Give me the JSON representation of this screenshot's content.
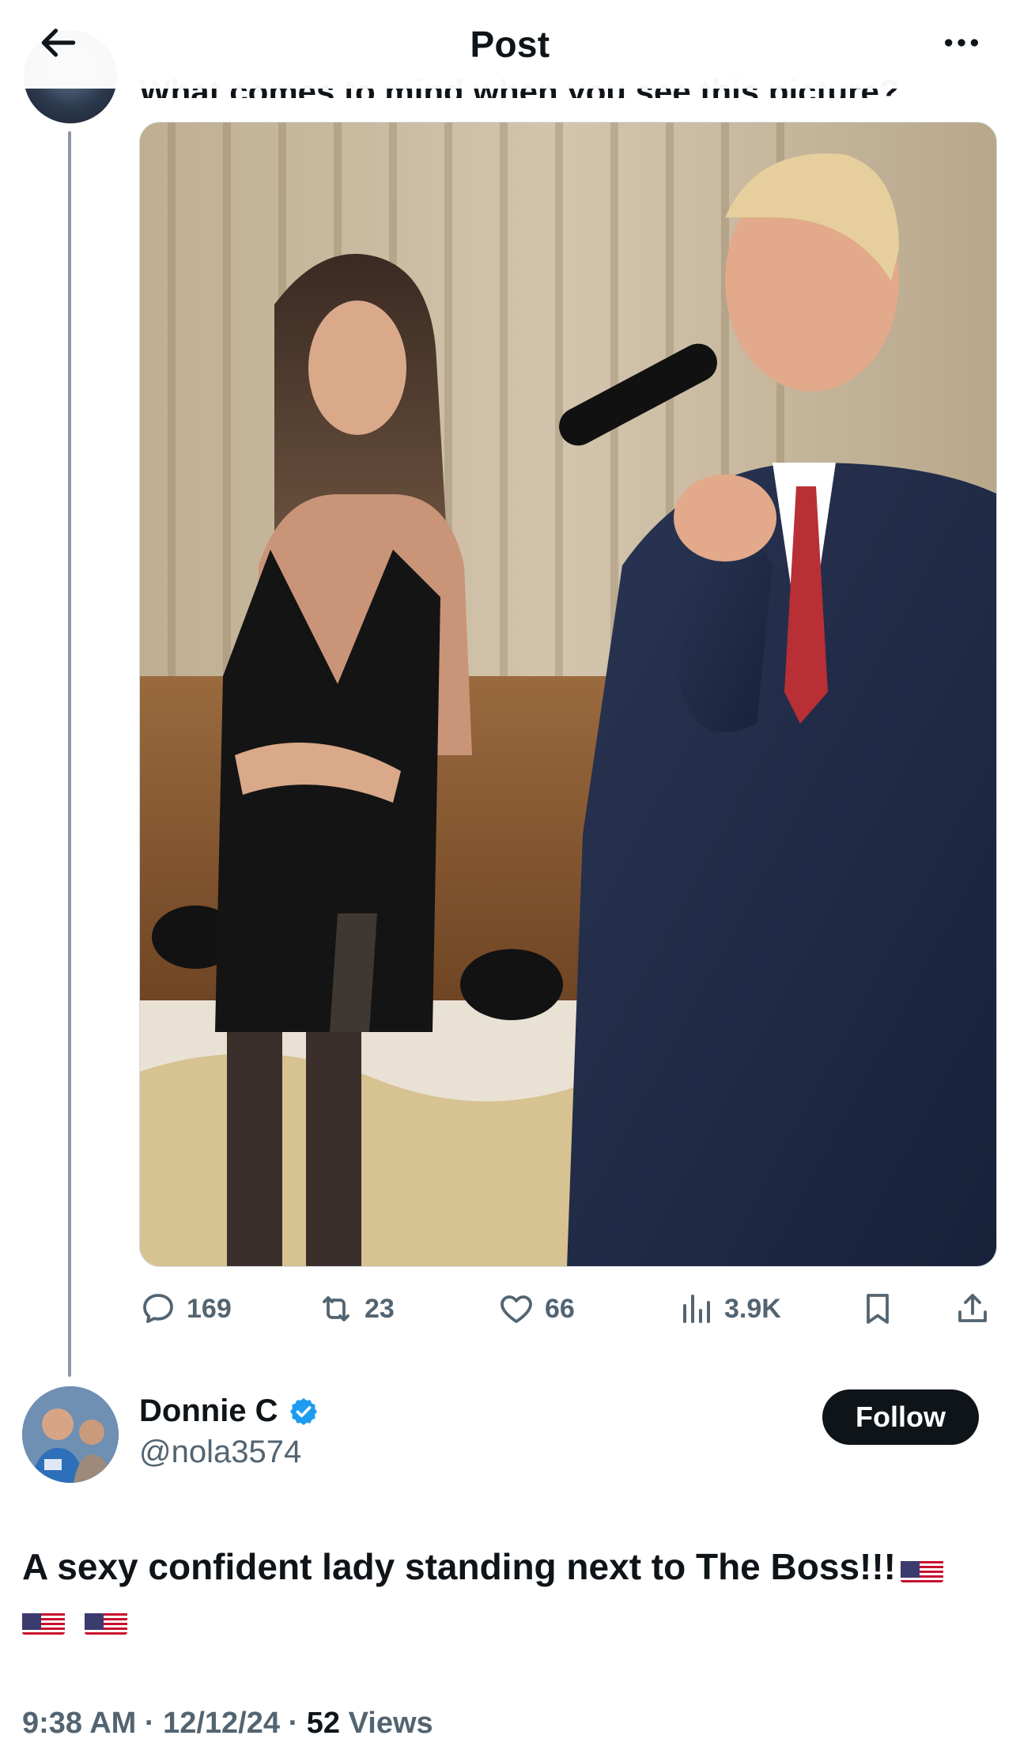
{
  "header": {
    "title": "Post",
    "back_icon": "arrow-left-icon",
    "more_icon": "more-horizontal-icon"
  },
  "previous_post": {
    "text_partial": "What comes to mind when you see this picture?"
  },
  "actions": {
    "replies": "169",
    "reposts": "23",
    "likes": "66",
    "views": "3.9K",
    "reply_icon": "reply-icon",
    "repost_icon": "repost-icon",
    "like_icon": "heart-icon",
    "views_icon": "views-chart-icon",
    "bookmark_icon": "bookmark-icon",
    "share_icon": "share-icon"
  },
  "author": {
    "name": "Donnie C",
    "handle": "@nola3574",
    "verified_icon": "verified-badge-icon",
    "follow_label": "Follow"
  },
  "post": {
    "text": "A sexy confident lady standing next to The Boss!!!",
    "flags": [
      "flag-us-icon",
      "flag-us-icon",
      "flag-us-icon"
    ]
  },
  "meta": {
    "time": "9:38 AM",
    "separator": "·",
    "date": "12/12/24",
    "views_count": "52",
    "views_label": "Views"
  },
  "colors": {
    "text": "#0f1419",
    "secondary": "#536471",
    "verified": "#1d9bf0",
    "follow_bg": "#0f1419",
    "thread_line": "#8b98a5"
  }
}
